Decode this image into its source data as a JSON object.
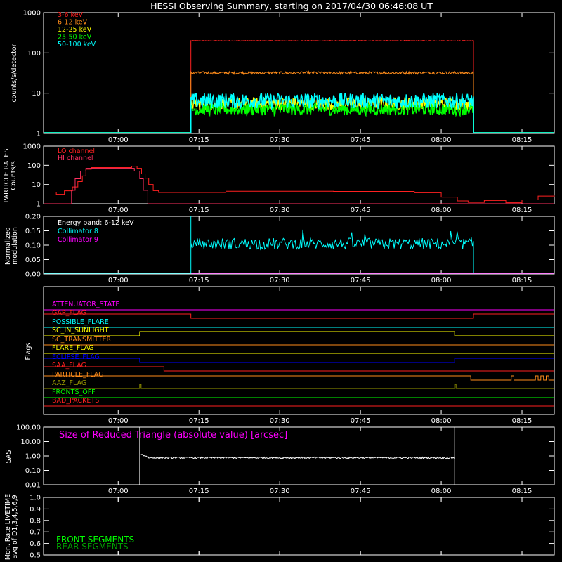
{
  "title": "HESSI Observing Summary, starting on 2017/04/30 06:46:08 UT",
  "time_ticks": [
    "07:00",
    "07:15",
    "07:30",
    "07:45",
    "08:00",
    "08:15"
  ],
  "time_range": [
    "06:46:08",
    "08:21:00"
  ],
  "colors": {
    "axis": "#ffffff",
    "red": "#ff2020",
    "orange": "#ff8c1a",
    "yellow": "#ffff00",
    "green": "#00ff00",
    "cyan": "#00ffff",
    "magenta": "#ff00ff",
    "blue": "#0000ff",
    "olive": "#9a9a00",
    "darkgreen": "#00a000"
  },
  "chart_data": [
    {
      "id": "count_rates",
      "type": "line",
      "ylabel": "counts/s/detector",
      "yscale": "log",
      "ylim": [
        1,
        1000
      ],
      "yticks": [
        "1",
        "10",
        "100",
        "1000"
      ],
      "observation_window": [
        "07:13:30",
        "08:06:00"
      ],
      "series": [
        {
          "name": "3-6 keV",
          "color": "red",
          "level": 200
        },
        {
          "name": "6-12 keV",
          "color": "orange",
          "level": 32
        },
        {
          "name": "12-25 keV",
          "color": "yellow",
          "level": 5.5
        },
        {
          "name": "25-50 keV",
          "color": "green",
          "level": 4.0
        },
        {
          "name": "50-100 keV",
          "color": "cyan",
          "level": 6.5
        }
      ]
    },
    {
      "id": "particle_rates",
      "type": "line",
      "ylabel": "PARTICLE RATES Counts/s",
      "yscale": "log",
      "ylim": [
        1,
        1000
      ],
      "yticks": [
        "1",
        "10",
        "100",
        "1000"
      ],
      "series": [
        {
          "name": "LO channel",
          "color": "red"
        },
        {
          "name": "HI channel",
          "color": "red"
        }
      ]
    },
    {
      "id": "modulation",
      "type": "line",
      "ylabel": "Normalized modulation",
      "ylim": [
        0.0,
        0.2
      ],
      "yticks": [
        "0.00",
        "0.05",
        "0.10",
        "0.15",
        "0.20"
      ],
      "energy_band": "Energy band: 6-12 keV",
      "series": [
        {
          "name": "Collimator 8",
          "color": "cyan",
          "level": 0.105
        },
        {
          "name": "Collimator 9",
          "color": "magenta",
          "level": 0.0
        }
      ]
    },
    {
      "id": "flags",
      "type": "line",
      "ylabel": "Flags",
      "flags": [
        {
          "name": "ATTENUATOR_STATE",
          "color": "magenta"
        },
        {
          "name": "GAP_FLAG",
          "color": "red"
        },
        {
          "name": "POSSIBLE_FLARE",
          "color": "cyan"
        },
        {
          "name": "SC_IN_SUNLIGHT",
          "color": "yellow"
        },
        {
          "name": "SC_TRANSMITTER",
          "color": "orange"
        },
        {
          "name": "FLARE_FLAG",
          "color": "yellow"
        },
        {
          "name": "ECLIPSE_FLAG",
          "color": "blue"
        },
        {
          "name": "SAA_FLAG",
          "color": "red"
        },
        {
          "name": "PARTICLE_FLAG",
          "color": "orange"
        },
        {
          "name": "AAZ_FLAG",
          "color": "olive"
        },
        {
          "name": "FRONTS_OFF",
          "color": "green"
        },
        {
          "name": "BAD_PACKETS",
          "color": "red"
        }
      ]
    },
    {
      "id": "sas",
      "type": "line",
      "ylabel": "SAS",
      "yscale": "log",
      "ylim": [
        0.01,
        100
      ],
      "yticks": [
        "0.01",
        "0.10",
        "1.00",
        "10.00",
        "100.00"
      ],
      "annotation": "Size of Reduced Triangle (absolute value) [arcsec]",
      "level": 0.75
    },
    {
      "id": "livetime",
      "type": "line",
      "ylabel": "Mon. Rate LIVETIME avg of D1,3,4,5,6,9",
      "ylim": [
        0.5,
        1.0
      ],
      "yticks": [
        "0.5",
        "0.6",
        "0.7",
        "0.8",
        "0.9",
        "1.0"
      ],
      "legend": [
        {
          "name": "FRONT SEGMENTS",
          "color": "green"
        },
        {
          "name": "REAR SEGMENTS",
          "color": "darkgreen"
        }
      ]
    }
  ]
}
